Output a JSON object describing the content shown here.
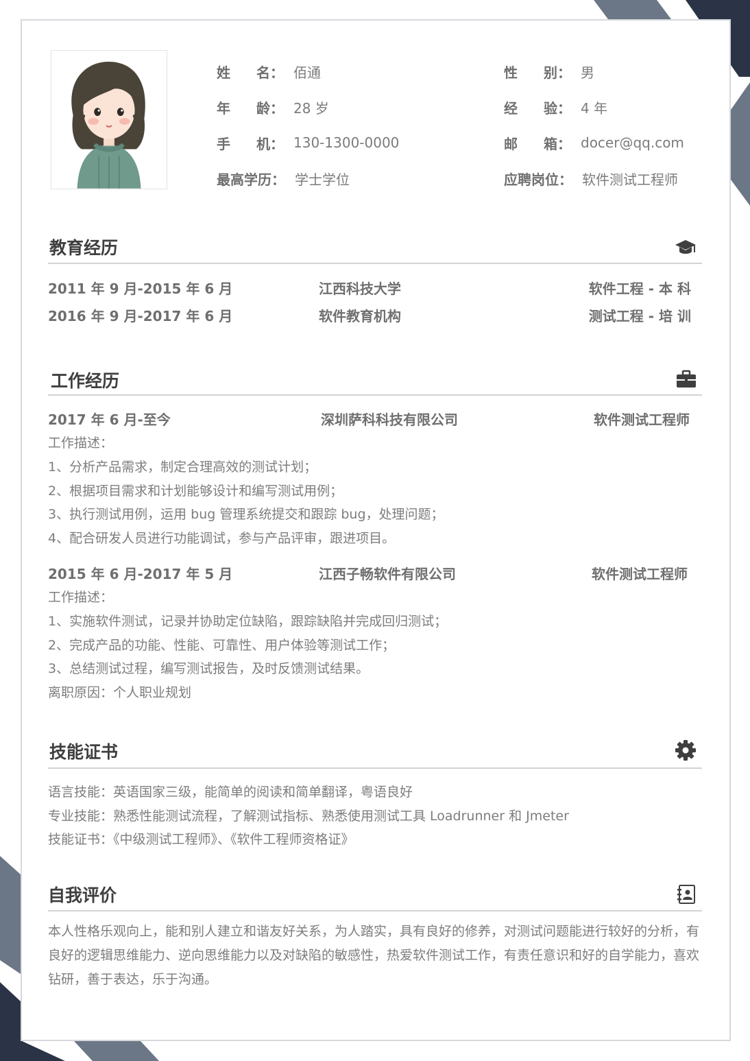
{
  "profile": {
    "rows": [
      {
        "left_label": "姓名",
        "left_value": "佰通",
        "right_label": "性别",
        "right_value": "男"
      },
      {
        "left_label": "年龄",
        "left_value": "28 岁",
        "right_label": "经验",
        "right_value": "4 年"
      },
      {
        "left_label": "手机",
        "left_value": "130-1300-0000",
        "right_label": "邮箱",
        "right_value": "docer@qq.com"
      },
      {
        "left_label": "最高学历",
        "left_value": "学士学位",
        "right_label": "应聘岗位",
        "right_value": "软件测试工程师"
      }
    ],
    "colon": "："
  },
  "education": {
    "title": "教育经历",
    "icon": "graduation-cap-icon",
    "entries": [
      {
        "period": "2011 年 9 月-2015 年 6 月",
        "school": "江西科技大学",
        "major": "软件工程 - 本 科"
      },
      {
        "period": "2016 年 9 月-2017 年 6 月",
        "school": "软件教育机构",
        "major": "测试工程 - 培 训"
      }
    ]
  },
  "work": {
    "title": "工作经历",
    "icon": "briefcase-icon",
    "jobs": [
      {
        "period": "2017 年 6 月-至今",
        "company": "深圳萨科科技有限公司",
        "position": "软件测试工程师",
        "desc_label": "工作描述：",
        "lines": [
          "1、分析产品需求，制定合理高效的测试计划；",
          "2、根据项目需求和计划能够设计和编写测试用例；",
          "3、执行测试用例，运用 bug 管理系统提交和跟踪 bug，处理问题；",
          "4、配合研发人员进行功能调试，参与产品评审，跟进项目。"
        ]
      },
      {
        "period": "2015 年 6 月-2017 年 5 月",
        "company": "江西子畅软件有限公司",
        "position": "软件测试工程师",
        "desc_label": "工作描述：",
        "lines": [
          "1、实施软件测试，记录并协助定位缺陷，跟踪缺陷并完成回归测试；",
          "2、完成产品的功能、性能、可靠性、用户体验等测试工作；",
          "3、总结测试过程，编写测试报告，及时反馈测试结果。",
          "离职原因：个人职业规划"
        ]
      }
    ]
  },
  "skills": {
    "title": "技能证书",
    "icon": "gear-icon",
    "lines": [
      "语言技能：英语国家三级，能简单的阅读和简单翻译，粤语良好",
      "专业技能：熟悉性能测试流程，了解测试指标、熟悉使用测试工具 Loadrunner 和 Jmeter",
      "技能证书：《中级测试工程师》、《软件工程师资格证》"
    ]
  },
  "self": {
    "title": "自我评价",
    "icon": "address-book-icon",
    "text": "本人性格乐观向上，能和别人建立和谐友好关系，为人踏实，具有良好的修养，对测试问题能进行较好的分析，有良好的逻辑思维能力、逆向思维能力以及对缺陷的敏感性，热爱软件测试工作，有责任意识和好的自学能力，喜欢钻研，善于表达，乐于沟通。"
  },
  "colors": {
    "dark_navy": "#2b3446",
    "slate": "#6b7686",
    "line": "#d3d3d3",
    "title": "#3f3f3f"
  }
}
